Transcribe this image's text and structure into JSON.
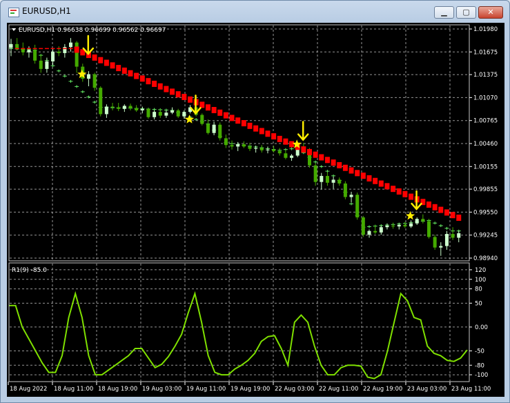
{
  "window": {
    "title": "EURUSD,H1",
    "minimize_glyph": "▁",
    "maximize_glyph": "▢",
    "close_glyph": "✕",
    "icon": "chart-window-icon"
  },
  "colors": {
    "background": "#000000",
    "grid": "#c8c8c8",
    "axis_text": "#ffffff",
    "bull_candle": "#ccffcc",
    "bear_candle": "#44aa00",
    "trend_line": "#ff0000",
    "support_line": "#66ee66",
    "signal": "#ffee00",
    "oscillator": "#7fe000"
  },
  "main_panel": {
    "header": "EURUSD,H1  0.96638 0.96699 0.96562 0.96697",
    "price_labels": [
      "1.01980",
      "1.01675",
      "1.01375",
      "1.01070",
      "1.00765",
      "1.00460",
      "1.00155",
      "0.99855",
      "0.99550",
      "0.99245",
      "0.98940"
    ]
  },
  "sub_panel": {
    "header": "R1(9) -85.0",
    "level_labels": [
      "120",
      "100",
      "80",
      "50",
      "0.00",
      "-50",
      "-80",
      "-100"
    ]
  },
  "time_labels": [
    "18 Aug 2022",
    "18 Aug 11:00",
    "18 Aug 19:00",
    "19 Aug 03:00",
    "19 Aug 11:00",
    "19 Aug 19:00",
    "22 Aug 03:00",
    "22 Aug 11:00",
    "22 Aug 19:00",
    "23 Aug 03:00",
    "23 Aug 11:00"
  ],
  "chart_data": {
    "type": "candlestick",
    "symbol": "EURUSD",
    "timeframe": "H1",
    "ylim": [
      0.9894,
      1.0198
    ],
    "last_bar": {
      "open": 0.96638,
      "high": 0.96699,
      "low": 0.96562,
      "close": 0.96697
    },
    "candles": [
      [
        1.0173,
        1.0185,
        1.0162,
        1.0178
      ],
      [
        1.0178,
        1.0186,
        1.017,
        1.0172
      ],
      [
        1.0172,
        1.018,
        1.0163,
        1.0167
      ],
      [
        1.0167,
        1.0175,
        1.016,
        1.017
      ],
      [
        1.017,
        1.0177,
        1.0152,
        1.0156
      ],
      [
        1.0156,
        1.0164,
        1.014,
        1.0145
      ],
      [
        1.0145,
        1.016,
        1.014,
        1.0155
      ],
      [
        1.0155,
        1.0172,
        1.015,
        1.0168
      ],
      [
        1.0168,
        1.0175,
        1.0162,
        1.0166
      ],
      [
        1.0166,
        1.0178,
        1.016,
        1.0174
      ],
      [
        1.0174,
        1.0186,
        1.0168,
        1.018
      ],
      [
        1.018,
        1.0182,
        1.014,
        1.0148
      ],
      [
        1.0148,
        1.0152,
        1.0128,
        1.0132
      ],
      [
        1.0132,
        1.0142,
        1.0122,
        1.0138
      ],
      [
        1.0138,
        1.014,
        1.0116,
        1.012
      ],
      [
        1.012,
        1.0122,
        1.0082,
        1.0085
      ],
      [
        1.0085,
        1.0098,
        1.008,
        1.0095
      ],
      [
        1.0095,
        1.01,
        1.009,
        1.0094
      ],
      [
        1.0094,
        1.01,
        1.0089,
        1.0092
      ],
      [
        1.0092,
        1.0098,
        1.0088,
        1.0096
      ],
      [
        1.0096,
        1.0099,
        1.009,
        1.0093
      ],
      [
        1.0093,
        1.0097,
        1.0088,
        1.009
      ],
      [
        1.009,
        1.0095,
        1.0086,
        1.0092
      ],
      [
        1.0092,
        1.0093,
        1.0079,
        1.0081
      ],
      [
        1.0081,
        1.009,
        1.0078,
        1.0088
      ],
      [
        1.0088,
        1.0092,
        1.008,
        1.0083
      ],
      [
        1.0083,
        1.009,
        1.008,
        1.0087
      ],
      [
        1.0087,
        1.0094,
        1.0085,
        1.009
      ],
      [
        1.009,
        1.0092,
        1.008,
        1.0082
      ],
      [
        1.0082,
        1.009,
        1.0079,
        1.0088
      ],
      [
        1.0088,
        1.0097,
        1.0086,
        1.0094
      ],
      [
        1.0094,
        1.0095,
        1.0082,
        1.0084
      ],
      [
        1.0084,
        1.0086,
        1.007,
        1.0072
      ],
      [
        1.0072,
        1.0078,
        1.0058,
        1.006
      ],
      [
        1.006,
        1.0075,
        1.0057,
        1.0071
      ],
      [
        1.0071,
        1.0074,
        1.005,
        1.0053
      ],
      [
        1.0053,
        1.0058,
        1.004,
        1.0044
      ],
      [
        1.0044,
        1.005,
        1.0038,
        1.0042
      ],
      [
        1.0042,
        1.0048,
        1.0036,
        1.0045
      ],
      [
        1.0045,
        1.0049,
        1.004,
        1.0042
      ],
      [
        1.0042,
        1.0047,
        1.0036,
        1.0039
      ],
      [
        1.0039,
        1.0043,
        1.0034,
        1.004
      ],
      [
        1.004,
        1.0044,
        1.0034,
        1.0037
      ],
      [
        1.0037,
        1.0042,
        1.0033,
        1.0038
      ],
      [
        1.0038,
        1.0043,
        1.0034,
        1.0036
      ],
      [
        1.0036,
        1.004,
        1.003,
        1.0033
      ],
      [
        1.0033,
        1.0038,
        1.0025,
        1.0027
      ],
      [
        1.0027,
        1.0032,
        1.0023,
        1.003
      ],
      [
        1.003,
        1.0044,
        1.0028,
        1.0041
      ],
      [
        1.0041,
        1.0047,
        1.0034,
        1.0038
      ],
      [
        1.0038,
        1.004,
        1.0014,
        1.0017
      ],
      [
        1.0017,
        1.002,
        0.999,
        0.9995
      ],
      [
        0.9995,
        1.0007,
        0.9985,
        1.0003
      ],
      [
        1.0003,
        1.0008,
        0.999,
        0.9994
      ],
      [
        0.9994,
        1.0002,
        0.9986,
        0.9998
      ],
      [
        0.9998,
        1.0001,
        0.999,
        0.9993
      ],
      [
        0.9993,
        0.9996,
        0.9972,
        0.9975
      ],
      [
        0.9975,
        0.9982,
        0.9968,
        0.9978
      ],
      [
        0.9978,
        0.9981,
        0.9945,
        0.9948
      ],
      [
        0.9948,
        0.995,
        0.9922,
        0.9925
      ],
      [
        0.9925,
        0.9932,
        0.9921,
        0.993
      ],
      [
        0.993,
        0.9938,
        0.9926,
        0.9928
      ],
      [
        0.9928,
        0.9937,
        0.9925,
        0.9935
      ],
      [
        0.9935,
        0.994,
        0.9932,
        0.9937
      ],
      [
        0.9937,
        0.9941,
        0.9933,
        0.9936
      ],
      [
        0.9936,
        0.994,
        0.9932,
        0.9938
      ],
      [
        0.9938,
        0.9942,
        0.9934,
        0.9936
      ],
      [
        0.9936,
        0.9944,
        0.9934,
        0.994
      ],
      [
        0.994,
        0.9948,
        0.9938,
        0.9946
      ],
      [
        0.9946,
        0.9952,
        0.994,
        0.9943
      ],
      [
        0.9943,
        0.9946,
        0.992,
        0.9922
      ],
      [
        0.9922,
        0.9925,
        0.9905,
        0.9908
      ],
      [
        0.9908,
        0.9915,
        0.9897,
        0.991
      ],
      [
        0.991,
        0.993,
        0.9905,
        0.9926
      ],
      [
        0.9926,
        0.9935,
        0.9918,
        0.9921
      ],
      [
        0.9921,
        0.993,
        0.9915,
        0.9927
      ]
    ],
    "trend_line": {
      "start_index": 11,
      "start": 1.0171,
      "end": 0.9948
    },
    "support_line": [
      [
        0,
        1.0172
      ],
      [
        4,
        1.017
      ],
      [
        15,
        1.0094
      ],
      [
        20,
        1.0093
      ],
      [
        27,
        1.009
      ],
      [
        33,
        1.0072
      ],
      [
        36,
        1.0047
      ],
      [
        45,
        1.0037
      ],
      [
        48,
        1.004
      ],
      [
        55,
        0.9997
      ],
      [
        59,
        0.9935
      ],
      [
        66,
        0.994
      ],
      [
        70,
        0.9944
      ],
      [
        74,
        0.993
      ]
    ],
    "signals": [
      {
        "index": 12,
        "arrow_price": 1.0165,
        "star_price": 1.0138
      },
      {
        "index": 30,
        "arrow_price": 1.0086,
        "star_price": 1.0078
      },
      {
        "index": 48,
        "arrow_price": 1.0051,
        "star_price": 1.0045
      },
      {
        "index": 67,
        "arrow_price": 0.9959,
        "star_price": 0.995
      }
    ],
    "oscillator": {
      "name": "R1(9)",
      "current": -85.0,
      "ylim": [
        -110,
        130
      ],
      "levels": [
        120,
        100,
        80,
        50,
        0,
        -50,
        -80,
        -100
      ],
      "values": [
        45,
        45,
        0,
        -25,
        -50,
        -75,
        -95,
        -95,
        -60,
        20,
        70,
        20,
        -60,
        -100,
        -100,
        -90,
        -80,
        -70,
        -60,
        -45,
        -45,
        -65,
        -85,
        -78,
        -62,
        -40,
        -15,
        30,
        70,
        10,
        -60,
        -95,
        -100,
        -100,
        -88,
        -80,
        -70,
        -55,
        -30,
        -20,
        -18,
        -45,
        -80,
        10,
        25,
        10,
        -40,
        -80,
        -100,
        -100,
        -85,
        -80,
        -80,
        -82,
        -105,
        -108,
        -100,
        -50,
        10,
        70,
        55,
        20,
        15,
        -40,
        -55,
        -60,
        -70,
        -72,
        -65,
        -48
      ]
    }
  }
}
